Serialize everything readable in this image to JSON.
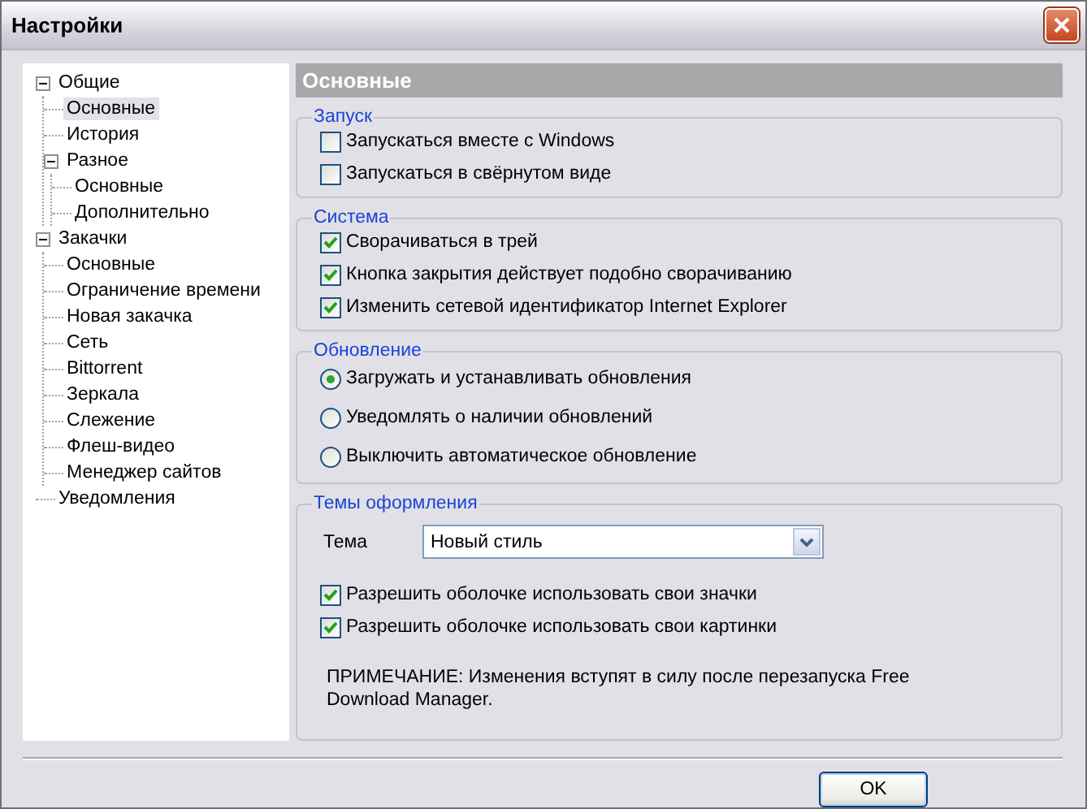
{
  "window": {
    "title": "Настройки"
  },
  "tree": [
    {
      "label": "Общие",
      "expanded": true,
      "selected": false,
      "children": [
        {
          "label": "Основные",
          "selected": true
        },
        {
          "label": "История",
          "selected": false
        },
        {
          "label": "Разное",
          "expanded": true,
          "selected": false,
          "children": [
            {
              "label": "Основные",
              "selected": false
            },
            {
              "label": "Дополнительно",
              "selected": false
            }
          ]
        }
      ]
    },
    {
      "label": "Закачки",
      "expanded": true,
      "selected": false,
      "children": [
        {
          "label": "Основные",
          "selected": false
        },
        {
          "label": "Ограничение времени",
          "selected": false
        },
        {
          "label": "Новая закачка",
          "selected": false
        },
        {
          "label": "Сеть",
          "selected": false
        },
        {
          "label": "Bittorrent",
          "selected": false
        },
        {
          "label": "Зеркала",
          "selected": false
        },
        {
          "label": "Слежение",
          "selected": false
        },
        {
          "label": "Флеш-видео",
          "selected": false
        },
        {
          "label": "Менеджер сайтов",
          "selected": false
        }
      ]
    },
    {
      "label": "Уведомления",
      "selected": false
    }
  ],
  "page": {
    "title": "Основные"
  },
  "groups": [
    {
      "title": "Запуск",
      "items": [
        {
          "kind": "checkbox",
          "label": "Запускаться вместе с Windows",
          "checked": false
        },
        {
          "kind": "checkbox",
          "label": "Запускаться в свёрнутом виде",
          "checked": false
        }
      ]
    },
    {
      "title": "Система",
      "items": [
        {
          "kind": "checkbox",
          "label": "Сворачиваться в трей",
          "checked": true
        },
        {
          "kind": "checkbox",
          "label": "Кнопка закрытия действует подобно сворачиванию",
          "checked": true
        },
        {
          "kind": "checkbox",
          "label": "Изменить сетевой идентификатор Internet Explorer",
          "checked": true
        }
      ]
    },
    {
      "title": "Обновление",
      "items": [
        {
          "kind": "radio",
          "label": "Загружать и устанавливать обновления",
          "selected": true
        },
        {
          "kind": "radio",
          "label": "Уведомлять о наличии обновлений",
          "selected": false
        },
        {
          "kind": "radio",
          "label": "Выключить автоматическое обновление",
          "selected": false
        }
      ]
    },
    {
      "title": "Темы оформления",
      "items": [
        {
          "kind": "select",
          "label": "Тема",
          "value": "Новый стиль"
        },
        {
          "kind": "checkbox",
          "label": "Разрешить оболочке использовать свои значки",
          "checked": true
        },
        {
          "kind": "checkbox",
          "label": "Разрешить оболочке использовать свои картинки",
          "checked": true
        },
        {
          "kind": "note",
          "text": "ПРИМЕЧАНИЕ: Изменения вступят в силу после перезапуска Free Download Manager."
        }
      ]
    }
  ],
  "buttons": [
    {
      "label": "OK"
    }
  ]
}
